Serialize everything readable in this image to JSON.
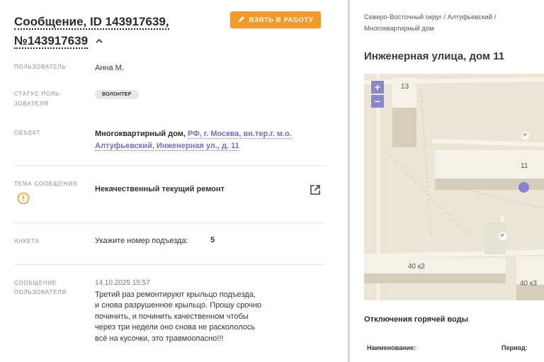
{
  "header": {
    "title_line1": "Сообщение, ID 143917639,",
    "title_line2": "№143917639",
    "take_button": "ВЗЯТЬ В РАБОТУ"
  },
  "fields": {
    "user_label": "ПОЛЬЗОВАТЕЛЬ",
    "user_value": "Анна М.",
    "status_label_1": "СТАТУС ПОЛЬ-",
    "status_label_2": "ЗОВАТЕЛЯ",
    "status_value": "ВОЛОНТЕР",
    "object_label": "ОБЪЕКТ",
    "object_type": "Многоквартирный дом, ",
    "object_link_1": "РФ, г. Москва, вн.тер.г. м.о.",
    "object_link_2": "Алтуфьевский, Инженерная ул., д. 11",
    "topic_label_1": "ТЕМА СООБЩЕНИЯ",
    "topic_value": "Некачественный текущий ремонт",
    "form_label": "АНКЕТА",
    "form_question": "Укажите номер подъезда:",
    "form_answer": "5",
    "message_label_1": "СООБЩЕНИЕ",
    "message_label_2": "ПОЛЬЗОВАТЕЛЯ",
    "message_date": "14.10.2025 15:57",
    "message_lines": [
      "Третий раз ремонтируют крыльцо подъезда,",
      "и снова разрушенное крыльцо. Прошу срочно",
      "починить, и починить качественном чтобы",
      "через три недели оно снова не раскололось",
      "всё на кусочки, это травмоопасно!!!"
    ]
  },
  "right": {
    "breadcrumb_line1": "Северо-Восточный округ / Алтуфьевский /",
    "breadcrumb_line2": "Многоквартирный дом",
    "address": "Инженерная улица, дом 11",
    "map": {
      "zoom_in": "+",
      "zoom_out": "−",
      "label_13": "13",
      "label_11": "11",
      "label_40k2": "40 к2",
      "label_40k3": "40 к3",
      "parking": "P",
      "marker_color": "#8a7fd0"
    },
    "section_title": "Отключения горячей воды",
    "col_name": "Наименование:",
    "col_period": "Период:"
  },
  "colors": {
    "accent": "#f19a2a",
    "link": "#7a6bc4",
    "warning": "#f19a2a"
  }
}
